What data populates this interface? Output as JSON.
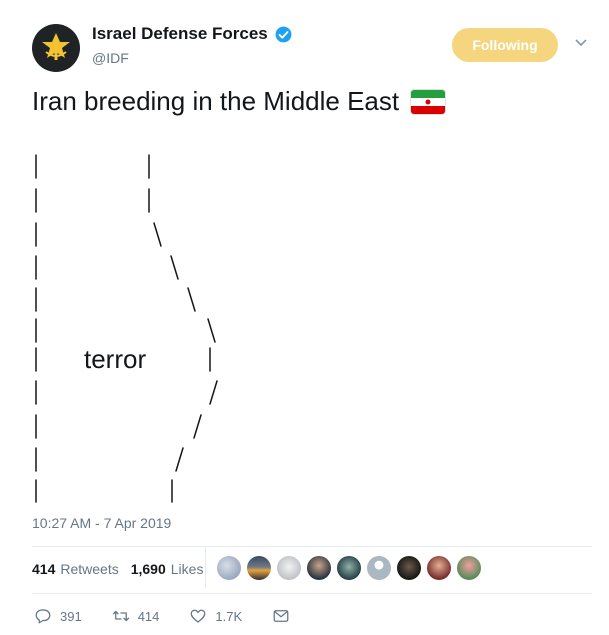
{
  "account": {
    "display_name": "Israel Defense Forces",
    "handle": "@IDF",
    "follow_label": "Following",
    "avatar_icon": "idf-emblem-icon",
    "verified_icon": "verified-badge-icon"
  },
  "tweet": {
    "text": "Iran breeding in the Middle East",
    "emoji_icon": "iran-flag-icon",
    "art_label": "terror",
    "timestamp": "10:27 AM - 7 Apr 2019"
  },
  "stats": {
    "retweets_count": "414",
    "retweets_label": "Retweets",
    "likes_count": "1,690",
    "likes_label": "Likes",
    "liker_avatar_count": 9
  },
  "actions": {
    "reply_count": "391",
    "retweet_count": "414",
    "like_count": "1.7K"
  },
  "colors": {
    "text": "#14171a",
    "muted": "#657786",
    "follow_button": "#f5d57d",
    "verified": "#1da1f2",
    "divider": "#e6ecf0"
  }
}
